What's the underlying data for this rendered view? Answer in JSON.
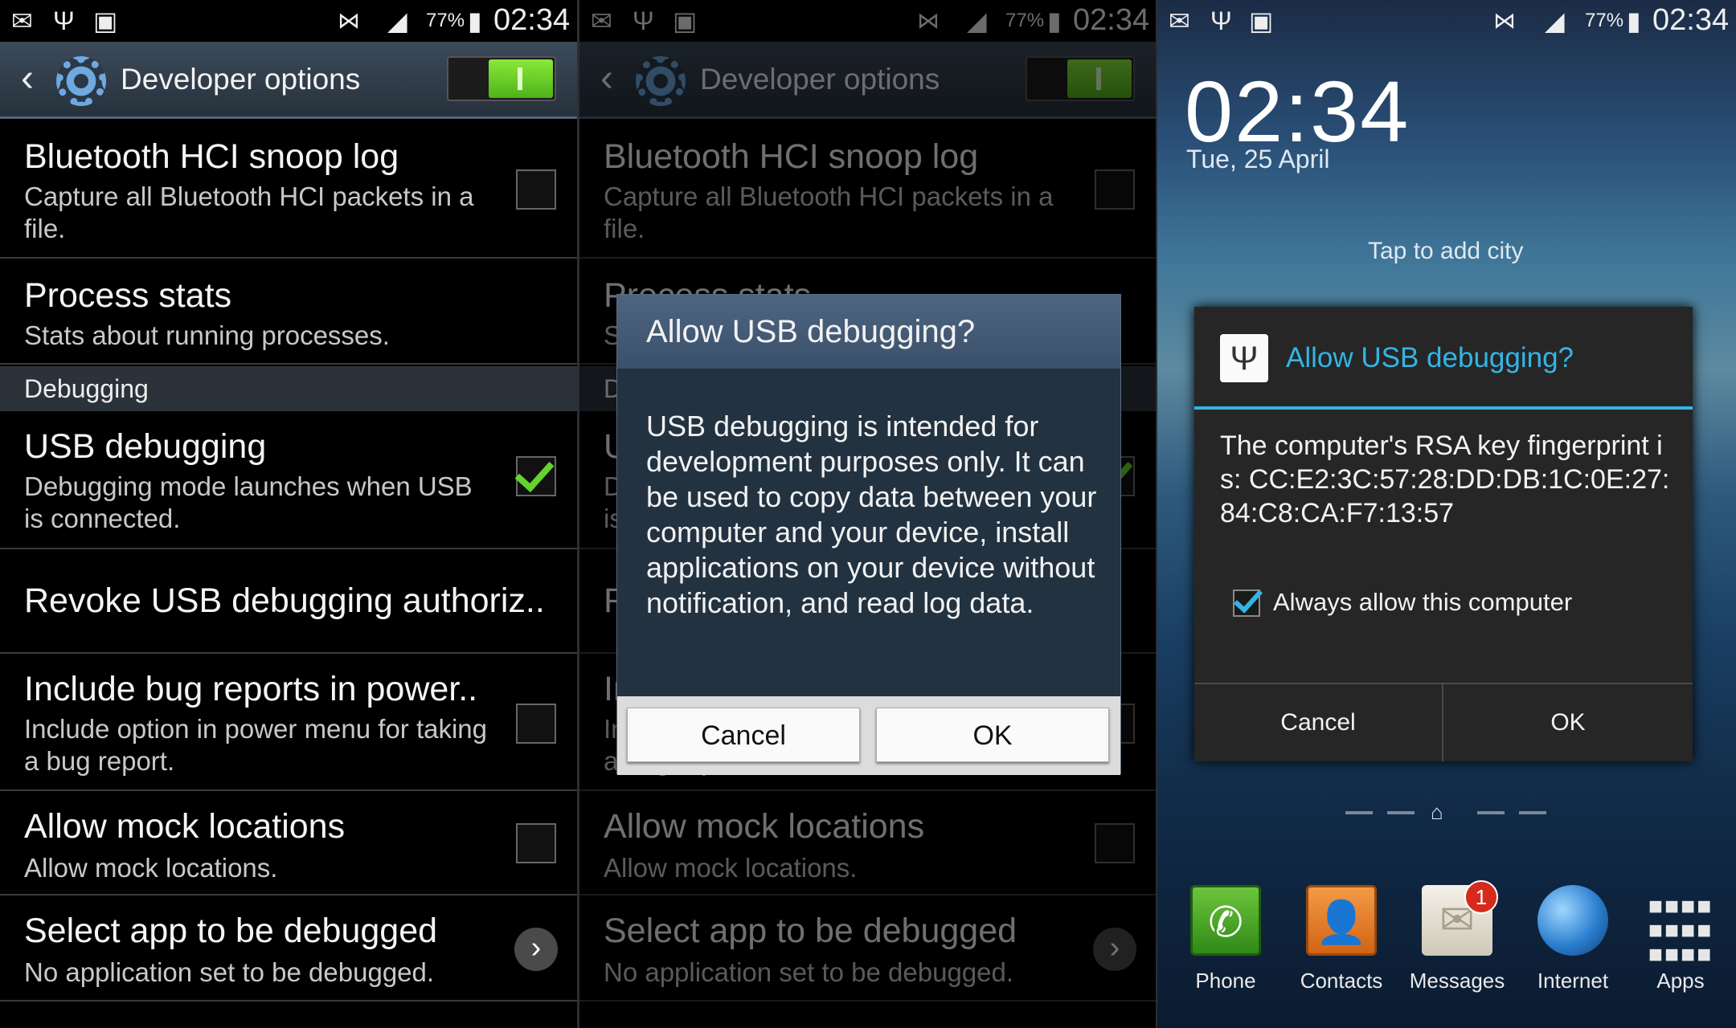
{
  "status": {
    "battery": "77%",
    "time": "02:34"
  },
  "header": {
    "title": "Developer options",
    "back_icon": "back-arrow-icon",
    "settings_icon": "gear-icon",
    "master_toggle": "on"
  },
  "settings": {
    "bt_title": "Bluetooth HCI snoop log",
    "bt_sub": "Capture all Bluetooth HCI packets in a file.",
    "ps_title": "Process stats",
    "ps_sub": "Stats about running processes.",
    "section_debugging": "Debugging",
    "usb_title": "USB debugging",
    "usb_sub": "Debugging mode launches when USB is connected.",
    "revoke_title": "Revoke USB debugging authoriz..",
    "bug_title": "Include bug reports in power..",
    "bug_sub": "Include option in power menu for taking a bug report.",
    "mock_title": "Allow mock locations",
    "mock_sub": "Allow mock locations.",
    "app_title": "Select app to be debugged",
    "app_sub": "No application set to be debugged."
  },
  "dialog1": {
    "title": "Allow USB debugging?",
    "body": "USB debugging is intended for development purposes only. It can be used to copy data between your computer and your device, install applications on your device without notification, and read log data.",
    "cancel": "Cancel",
    "ok": "OK"
  },
  "lockscreen": {
    "clock": "02:34",
    "date": "Tue, 25 April",
    "city_hint": "Tap to add city"
  },
  "dialog2": {
    "title": "Allow USB debugging?",
    "body": "The computer's RSA key fingerprint is: CC:E2:3C:57:28:DD:DB:1C:0E:27:84:C8:CA:F7:13:57",
    "checkbox_label": "Always allow this computer",
    "checkbox_checked": true,
    "cancel": "Cancel",
    "ok": "OK"
  },
  "dock": {
    "phone": "Phone",
    "contacts": "Contacts",
    "messages": "Messages",
    "messages_badge": "1",
    "internet": "Internet",
    "apps": "Apps"
  },
  "colors": {
    "accent_blue": "#33b5e5",
    "check_green": "#62d42b",
    "toggle_green": "#4fb21b"
  }
}
